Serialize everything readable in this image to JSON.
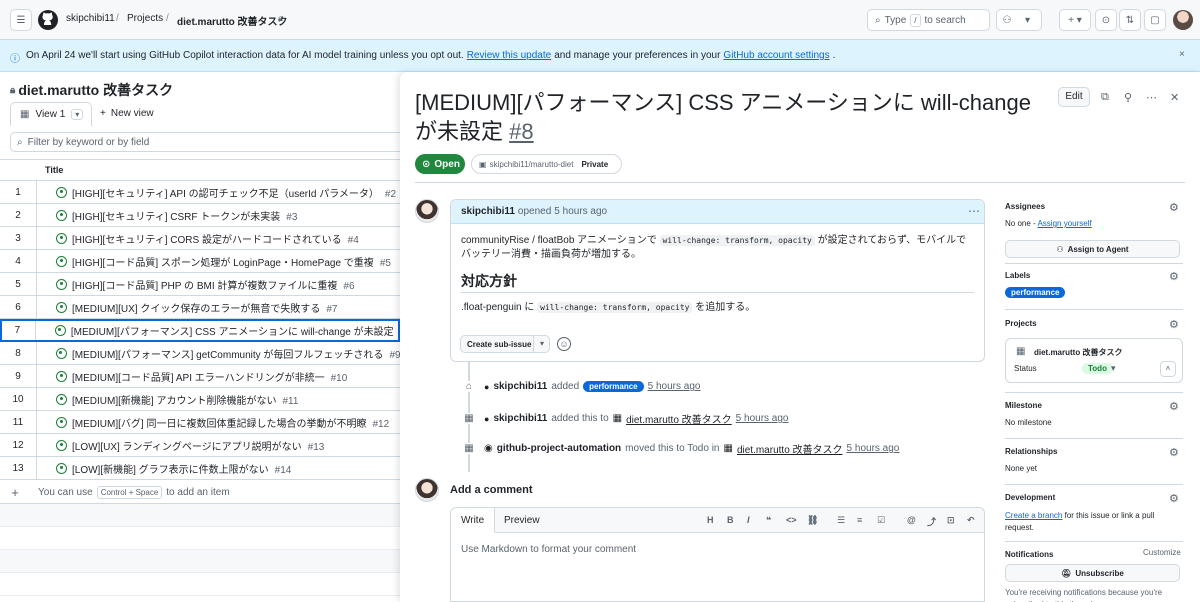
{
  "header": {
    "owner": "skipchibi11",
    "projects": "Projects",
    "project": "diet.marutto 改善タスク",
    "search_type": "Type",
    "search_key": "/",
    "search_rest": "to search"
  },
  "banner": {
    "pre": "On April 24 we'll start using GitHub Copilot interaction data for AI model training unless you opt out.",
    "link1": "Review this update",
    "mid": "and manage your preferences in your",
    "link2": "GitHub account settings",
    "end": "."
  },
  "project": {
    "title": "diet.marutto 改善タスク",
    "view_tab": "View 1",
    "new_view": "New view",
    "filter_placeholder": "Filter by keyword or by field",
    "column_title": "Title",
    "add_hint_pre": "You can use",
    "add_hint_kbd": "Control + Space",
    "add_hint_post": "to add an item",
    "rows": [
      {
        "n": "1",
        "title": "[HIGH][セキュリティ] API の認可チェック不足（userId パラメータ）",
        "issue": "#2"
      },
      {
        "n": "2",
        "title": "[HIGH][セキュリティ] CSRF トークンが未実装",
        "issue": "#3"
      },
      {
        "n": "3",
        "title": "[HIGH][セキュリティ] CORS 設定がハードコードされている",
        "issue": "#4"
      },
      {
        "n": "4",
        "title": "[HIGH][コード品質] スポーン処理が LoginPage・HomePage で重複",
        "issue": "#5"
      },
      {
        "n": "5",
        "title": "[HIGH][コード品質] PHP の BMI 計算が複数ファイルに重複",
        "issue": "#6"
      },
      {
        "n": "6",
        "title": "[MEDIUM][UX] クイック保存のエラーが無音で失敗する",
        "issue": "#7"
      },
      {
        "n": "7",
        "title": "[MEDIUM][パフォーマンス] CSS アニメーションに will-change が未設定",
        "issue": "#8"
      },
      {
        "n": "8",
        "title": "[MEDIUM][パフォーマンス] getCommunity が毎回フルフェッチされる",
        "issue": "#9"
      },
      {
        "n": "9",
        "title": "[MEDIUM][コード品質] API エラーハンドリングが非統一",
        "issue": "#10"
      },
      {
        "n": "10",
        "title": "[MEDIUM][新機能] アカウント削除機能がない",
        "issue": "#11"
      },
      {
        "n": "11",
        "title": "[MEDIUM][バグ] 同一日に複数回体重記録した場合の挙動が不明瞭",
        "issue": "#12"
      },
      {
        "n": "12",
        "title": "[LOW][UX] ランディングページにアプリ説明がない",
        "issue": "#13"
      },
      {
        "n": "13",
        "title": "[LOW][新機能] グラフ表示に件数上限がない",
        "issue": "#14"
      }
    ]
  },
  "issue": {
    "title": "[MEDIUM][パフォーマンス] CSS アニメーションに will-change が未設定",
    "number": "#8",
    "edit": "Edit",
    "state": "Open",
    "repo": "skipchibi11/marutto-diet",
    "visibility": "Private",
    "author": "skipchibi11",
    "opened": "opened",
    "opened_time": "5 hours ago",
    "body_pre": "communityRise / floatBob アニメーションで",
    "body_code": "will-change: transform, opacity",
    "body_post": "が設定されておらず、モバイルでバッテリー消費・描画負荷が増加する。",
    "heading": "対応方針",
    "fix_pre": ".float-penguin に",
    "fix_code": "will-change: transform, opacity",
    "fix_post": "を追加する。",
    "sub_issue": "Create sub-issue",
    "events": [
      {
        "actor": "skipchibi11",
        "verb": "added",
        "label": "performance",
        "time": "5 hours ago"
      },
      {
        "actor": "skipchibi11",
        "verb": "added this to",
        "target": "diet.marutto 改善タスク",
        "time": "5 hours ago"
      },
      {
        "actor": "github-project-automation",
        "verb": "moved this to Todo in",
        "target": "diet.marutto 改善タスク",
        "time": "5 hours ago"
      }
    ],
    "add_comment": "Add a comment",
    "tab_write": "Write",
    "tab_preview": "Preview",
    "comment_placeholder": "Use Markdown to format your comment"
  },
  "sidebar": {
    "assignees": "Assignees",
    "assignees_none": "No one -",
    "assign_self": "Assign yourself",
    "assign_agent": "Assign to Agent",
    "labels": "Labels",
    "label_perf": "performance",
    "projects": "Projects",
    "project_name": "diet.marutto 改善タスク",
    "status_label": "Status",
    "status_value": "Todo",
    "milestone": "Milestone",
    "milestone_none": "No milestone",
    "relationships": "Relationships",
    "relationships_none": "None yet",
    "development": "Development",
    "create_branch": "Create a branch",
    "dev_post": "for this issue or link a pull request.",
    "notifications": "Notifications",
    "customize": "Customize",
    "unsubscribe": "Unsubscribe",
    "notif_text": "You're receiving notifications because you're subscribed to this thread."
  },
  "colors": {
    "accent": "#0969da",
    "open": "#1f883d",
    "todo_bg": "#dafbe1"
  }
}
